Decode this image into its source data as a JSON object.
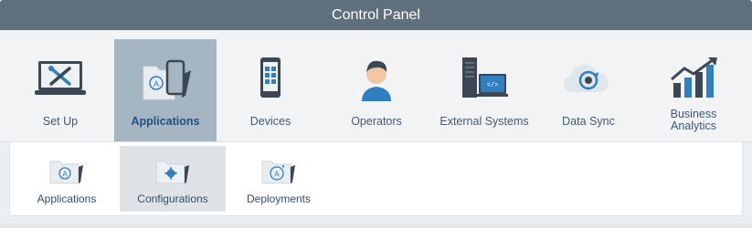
{
  "window": {
    "title": "Control Panel"
  },
  "nav": {
    "items": [
      {
        "label": "Set Up",
        "icon": "laptop-tools-icon"
      },
      {
        "label": "Applications",
        "icon": "folder-phone-icon",
        "selected": true
      },
      {
        "label": "Devices",
        "icon": "mobile-device-icon"
      },
      {
        "label": "Operators",
        "icon": "operator-icon"
      },
      {
        "label": "External Systems",
        "icon": "server-monitor-icon"
      },
      {
        "label": "Data Sync",
        "icon": "cloud-sync-icon"
      },
      {
        "label": "Business Analytics",
        "label_line1": "Business",
        "label_line2": "Analytics",
        "icon": "analytics-chart-icon"
      }
    ]
  },
  "subnav": {
    "items": [
      {
        "label": "Applications",
        "icon": "folder-app-icon"
      },
      {
        "label": "Configurations",
        "icon": "folder-gear-icon",
        "selected": true
      },
      {
        "label": "Deployments",
        "icon": "folder-deploy-icon"
      }
    ]
  },
  "colors": {
    "titlebar": "#5f6f7c",
    "selected_tab": "#a6b5c2",
    "selected_label": "#1f4f85",
    "accent_blue": "#2f7fc1",
    "dark_icon": "#3b4752"
  }
}
